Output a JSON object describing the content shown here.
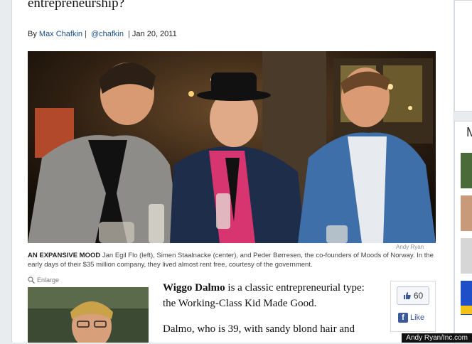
{
  "article": {
    "headline": "entrepreneurship?",
    "byline": {
      "prefix": "By",
      "author": "Max Chafkin",
      "separator": "|",
      "handle": "@chafkin",
      "date": "Jan 20, 2011"
    },
    "photo": {
      "credit": "Andy Ryan",
      "caption_kicker": "AN EXPANSIVE MOOD",
      "caption_text": "Jan Egil Flo (left), Simen Staalnacke (center), and Peder Børresen, the co-founders of Moods of Norway. In the early days of their $35 million company, they lived almost rent free, courtesy of the government.",
      "enlarge_label": "Enlarge"
    },
    "body": {
      "lead_bold": "Wiggo Dalmo",
      "lead_rest": " is a classic entrepreneurial type: the Working-Class Kid Made Good.",
      "para2": "Dalmo, who is 39, with sandy blond hair and"
    },
    "share": {
      "count": "60",
      "like_label": "Like"
    }
  },
  "watermark": "Andy Ryan/Inc.com",
  "sidebar": {
    "section_letter": "M"
  },
  "colors": {
    "link": "#1a4f8a",
    "facebook": "#3b5998"
  }
}
